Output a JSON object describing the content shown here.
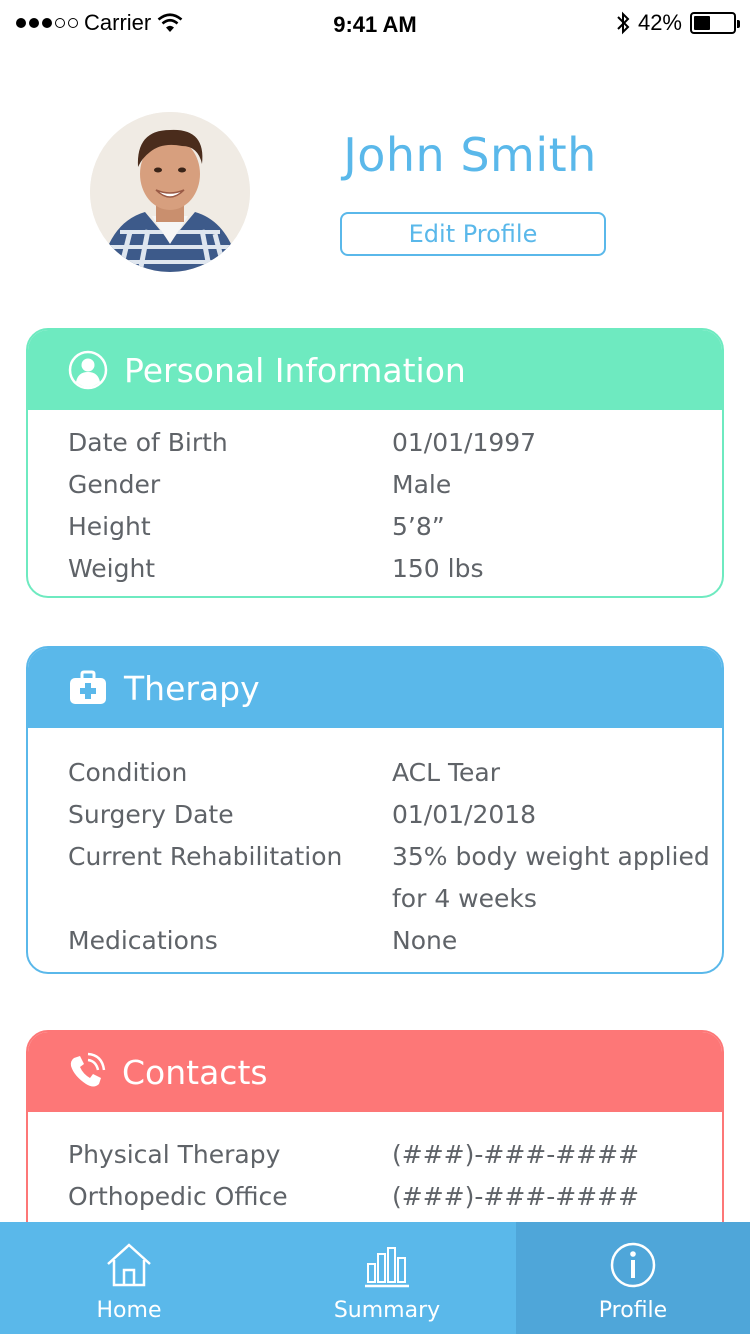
{
  "status_bar": {
    "carrier": "Carrier",
    "time": "9:41 AM",
    "battery": "42%",
    "battery_level": 0.42,
    "icons": [
      "signal-dots",
      "wifi-icon",
      "bluetooth-icon",
      "battery-icon"
    ]
  },
  "profile": {
    "name": "John Smith",
    "edit_label": "Edit Profile",
    "avatar_icon": "avatar-photo"
  },
  "personal": {
    "title": "Personal Information",
    "icon": "user-icon",
    "rows": [
      {
        "label": "Date of Birth",
        "value": "01/01/1997"
      },
      {
        "label": "Gender",
        "value": "Male"
      },
      {
        "label": "Height",
        "value": "5’8”"
      },
      {
        "label": "Weight",
        "value": "150 lbs"
      }
    ]
  },
  "therapy": {
    "title": "Therapy",
    "icon": "medical-kit-icon",
    "rows": [
      {
        "label": "Condition",
        "value": "ACL Tear"
      },
      {
        "label": "Surgery Date",
        "value": "01/01/2018"
      },
      {
        "label": "Current Rehabilitation",
        "value": "35% body weight applied"
      },
      {
        "label": "",
        "value": "for 4 weeks"
      },
      {
        "label": "Medications",
        "value": "None"
      }
    ]
  },
  "contacts": {
    "title": "Contacts",
    "icon": "phone-icon",
    "rows": [
      {
        "label": "Physical Therapy",
        "value": "(###)-###-####"
      },
      {
        "label": "Orthopedic Office",
        "value": "(###)-###-####"
      }
    ]
  },
  "tabs": [
    {
      "label": "Home",
      "icon": "home-icon"
    },
    {
      "label": "Summary",
      "icon": "bar-chart-icon"
    },
    {
      "label": "Profile",
      "icon": "info-icon",
      "active": true
    }
  ],
  "colors": {
    "accent_blue": "#5ab8ea",
    "personal_green": "#6eeac0",
    "contacts_red": "#fd7777",
    "active_tab": "#4fa6d9",
    "text": "#5f6368"
  }
}
